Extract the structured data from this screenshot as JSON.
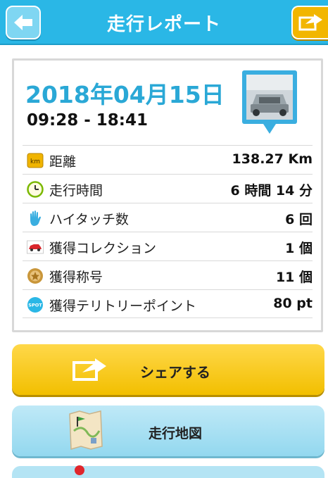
{
  "header": {
    "title": "走行レポート",
    "back_icon": "arrow-left-icon",
    "share_icon": "share-icon"
  },
  "report": {
    "date": "2018年04月15日",
    "time_range": "09:28 - 18:41",
    "rows": [
      {
        "icon": "km-icon",
        "label": "距離",
        "value": "138.27 Km"
      },
      {
        "icon": "clock-icon",
        "label": "走行時間",
        "value": "6 時間 14 分"
      },
      {
        "icon": "hand-icon",
        "label": "ハイタッチ数",
        "value": "6 回"
      },
      {
        "icon": "car-icon",
        "label": "獲得コレクション",
        "value": "1 個"
      },
      {
        "icon": "medal-icon",
        "label": "獲得称号",
        "value": "11 個"
      },
      {
        "icon": "spot-icon",
        "label": "獲得テリトリーポイント",
        "value": "80 pt"
      }
    ]
  },
  "buttons": {
    "share_label": "シェアする",
    "map_label": "走行地図"
  },
  "colors": {
    "header": "#2ab7e6",
    "date": "#2aa8d6",
    "share_button": "#f2bf00",
    "map_button": "#93d8ef"
  }
}
